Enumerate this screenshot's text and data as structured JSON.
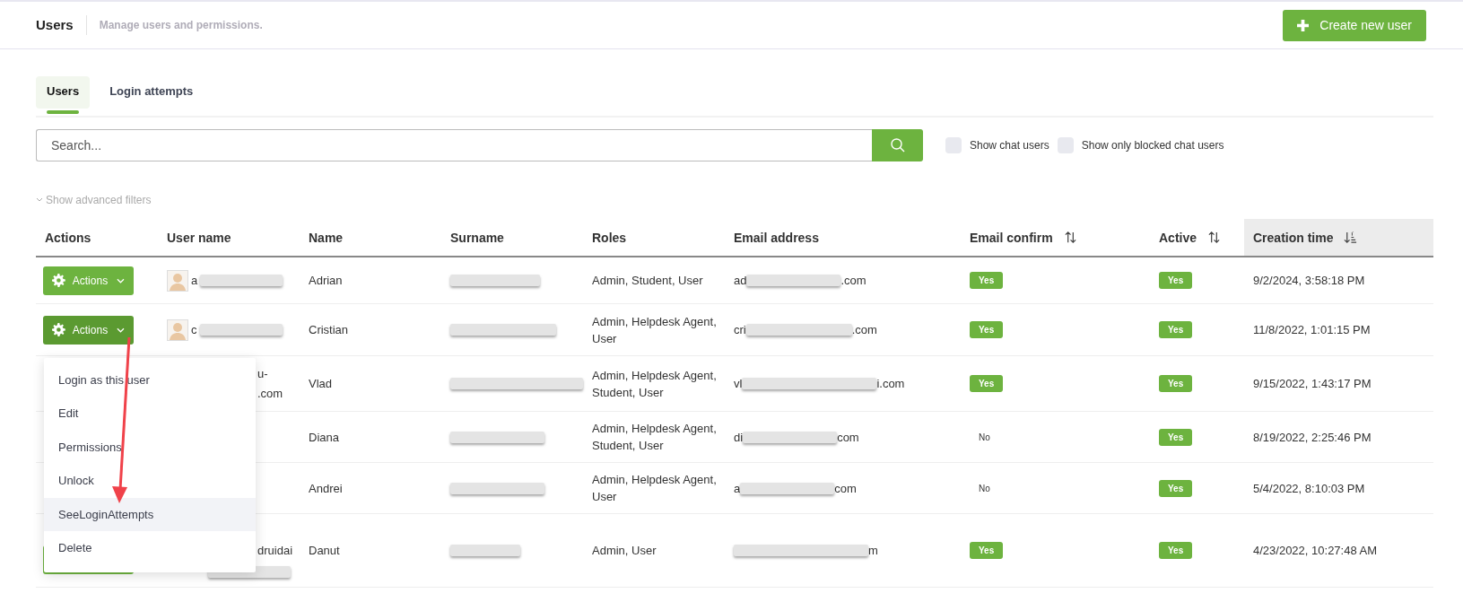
{
  "header": {
    "title": "Users",
    "subtitle": "Manage users and permissions.",
    "create_button": "Create new user"
  },
  "tabs": [
    {
      "label": "Users",
      "selected": true
    },
    {
      "label": "Login attempts",
      "selected": false
    }
  ],
  "search": {
    "placeholder": "Search..."
  },
  "filters": [
    {
      "label": "Show chat users",
      "checked": false
    },
    {
      "label": "Show only blocked chat users",
      "checked": false
    }
  ],
  "advanced_filters": "Show advanced filters",
  "table": {
    "columns": [
      {
        "label": "Actions",
        "kind": "plain"
      },
      {
        "label": "User name",
        "kind": "plain"
      },
      {
        "label": "Name",
        "kind": "plain"
      },
      {
        "label": "Surname",
        "kind": "plain"
      },
      {
        "label": "Roles",
        "kind": "plain"
      },
      {
        "label": "Email address",
        "kind": "plain"
      },
      {
        "label": "Email confirm",
        "kind": "sortable"
      },
      {
        "label": "Active",
        "kind": "sortable"
      },
      {
        "label": "Creation time",
        "kind": "sorted"
      }
    ],
    "rows": [
      {
        "actions": {
          "label": "Actions",
          "open": false
        },
        "username": {
          "avatar": true,
          "lines": [
            "a"
          ]
        },
        "name": "Adrian",
        "roles": "Admin, Student, User",
        "email": {
          "prefix": "ad",
          "suffix": ".com"
        },
        "email_confirm": {
          "text": "Yes",
          "on": true
        },
        "active": {
          "text": "Yes",
          "on": true
        },
        "created": "9/2/2024, 3:58:18 PM"
      },
      {
        "actions": {
          "label": "Actions",
          "open": true
        },
        "username": {
          "avatar": true,
          "lines": [
            "c"
          ]
        },
        "name": "Cristian",
        "roles": "Admin, Helpdesk Agent, User",
        "email": {
          "prefix": "cri",
          "suffix": ".com"
        },
        "email_confirm": {
          "text": "Yes",
          "on": true
        },
        "active": {
          "text": "Yes",
          "on": true
        },
        "created": "11/8/2022, 1:01:15 PM"
      },
      {
        "username": {
          "lines": [
            "u-",
            ".com"
          ]
        },
        "name": "Vlad",
        "roles": "Admin, Helpdesk Agent, Student, User",
        "email": {
          "prefix": "vl",
          "suffix": "i.com"
        },
        "email_confirm": {
          "text": "Yes",
          "on": true
        },
        "active": {
          "text": "Yes",
          "on": true
        },
        "created": "9/15/2022, 1:43:17 PM"
      },
      {
        "name": "Diana",
        "roles": "Admin, Helpdesk Agent, Student, User",
        "email": {
          "prefix": "di",
          "suffix": "com"
        },
        "email_confirm": {
          "text": "No",
          "on": false
        },
        "active": {
          "text": "Yes",
          "on": true
        },
        "created": "8/19/2022, 2:25:46 PM"
      },
      {
        "name": "Andrei",
        "roles": "Admin, Helpdesk Agent, User",
        "email": {
          "prefix": "a",
          "suffix": "com"
        },
        "email_confirm": {
          "text": "No",
          "on": false
        },
        "active": {
          "text": "Yes",
          "on": true
        },
        "created": "5/4/2022, 8:10:03 PM"
      },
      {
        "actions": {
          "open": false
        },
        "username": {
          "lines": [
            "druidai"
          ]
        },
        "name": "Danut",
        "roles": "Admin, User",
        "email": {
          "suffix": "m"
        },
        "email_confirm": {
          "text": "Yes",
          "on": true
        },
        "active": {
          "text": "Yes",
          "on": true
        },
        "created": "4/23/2022, 10:27:48 AM"
      }
    ]
  },
  "menu": {
    "items": [
      {
        "label": "Login as this user",
        "selected": false
      },
      {
        "label": "Edit",
        "selected": false
      },
      {
        "label": "Permissions",
        "selected": false
      },
      {
        "label": "Unlock",
        "selected": false
      },
      {
        "label": "SeeLoginAttempts",
        "selected": true
      },
      {
        "label": "Delete",
        "selected": false
      }
    ]
  },
  "annotations": [
    {
      "kind": "arrow"
    }
  ]
}
